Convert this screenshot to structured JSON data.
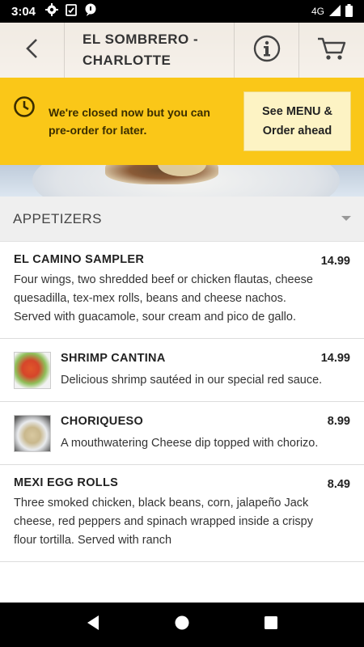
{
  "status_bar": {
    "time": "3:04",
    "network": "4G",
    "icons": [
      "gear-icon",
      "clipboard-check-icon",
      "chat-icon",
      "signal-icon",
      "battery-icon"
    ]
  },
  "header": {
    "title": "EL SOMBRERO -\nCHARLOTTE",
    "icons": [
      "chevron-left-icon",
      "info-icon",
      "cart-icon"
    ]
  },
  "closed_banner": {
    "message": "We're closed now but you can pre-order for later.",
    "button_label": "See MENU &\nOrder ahead",
    "icon": "clock-icon",
    "color": "#fac718"
  },
  "category": {
    "label": "APPETIZERS",
    "icon": "dropdown-arrow-icon"
  },
  "menu_items": [
    {
      "name": "EL CAMINO SAMPLER",
      "price": "14.99",
      "description": "Four wings, two shredded beef or chicken flautas, cheese quesadilla, tex-mex rolls, beans and cheese nachos. Served with guacamole, sour cream and pico de gallo."
    },
    {
      "name": "SHRIMP CANTINA",
      "price": "14.99",
      "description": "Delicious shrimp sautéed in our special red sauce."
    },
    {
      "name": "CHORIQUESO",
      "price": "8.99",
      "description": "A mouthwatering Cheese dip topped with chorizo."
    },
    {
      "name": "MEXI EGG ROLLS",
      "price": "8.49",
      "description": "Three smoked chicken, black beans, corn, jalapeño Jack cheese, red peppers and spinach wrapped inside a crispy flour tortilla. Served with ranch"
    }
  ],
  "nav_bar": {
    "icons": [
      "back-triangle-icon",
      "home-circle-icon",
      "recents-square-icon"
    ]
  }
}
